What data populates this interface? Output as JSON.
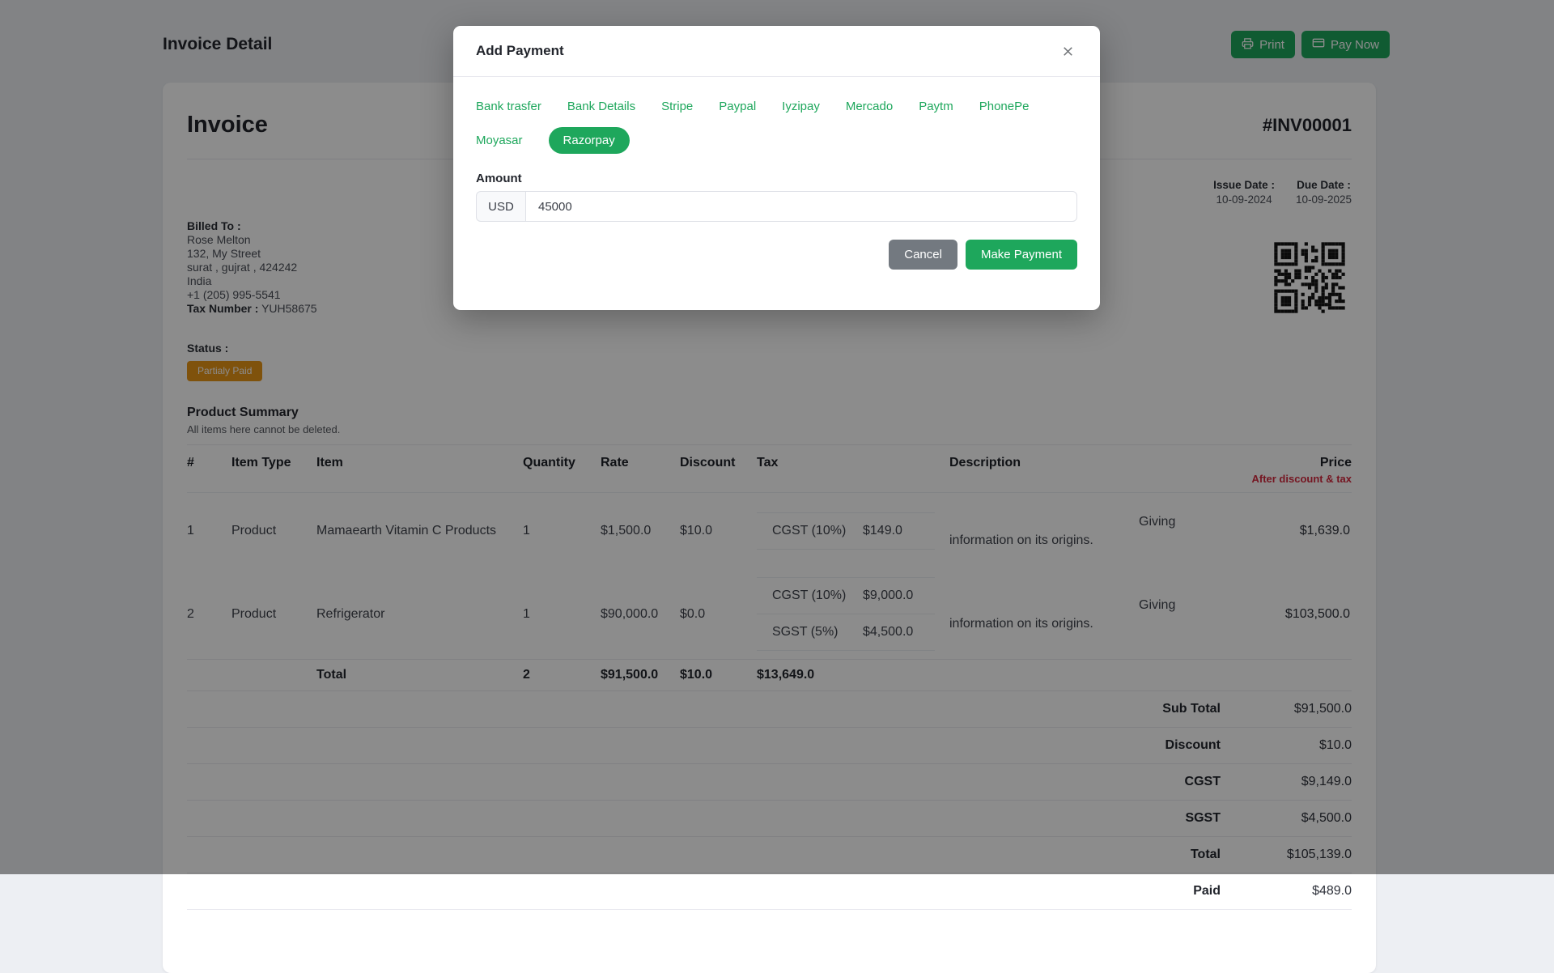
{
  "page": {
    "title": "Invoice Detail",
    "print_label": "Print",
    "pay_now_label": "Pay Now"
  },
  "invoice": {
    "heading": "Invoice",
    "number": "#INV00001",
    "issue_date_label": "Issue Date :",
    "issue_date": "10-09-2024",
    "due_date_label": "Due Date :",
    "due_date": "10-09-2025",
    "billed_to_label": "Billed To :",
    "billed_to": [
      "Rose Melton",
      "132, My Street",
      "surat , gujrat , 424242",
      "India",
      "+1 (205) 995-5541"
    ],
    "tax_number_label": "Tax Number :",
    "tax_number": "YUH58675",
    "status_label": "Status :",
    "status": "Partialy Paid"
  },
  "product_summary": {
    "title": "Product Summary",
    "subtitle": "All items here cannot be deleted.",
    "columns": [
      "#",
      "Item Type",
      "Item",
      "Quantity",
      "Rate",
      "Discount",
      "Tax",
      "Description",
      "Price"
    ],
    "price_subnote": "After discount & tax",
    "rows": [
      {
        "index": "1",
        "item_type": "Product",
        "item": "Mamaearth Vitamin C Products",
        "quantity": "1",
        "rate": "$1,500.0",
        "discount": "$10.0",
        "taxes": [
          {
            "name": "CGST (10%)",
            "amount": "$149.0"
          }
        ],
        "description": "Giving information on its origins.",
        "price": "$1,639.0"
      },
      {
        "index": "2",
        "item_type": "Product",
        "item": "Refrigerator",
        "quantity": "1",
        "rate": "$90,000.0",
        "discount": "$0.0",
        "taxes": [
          {
            "name": "CGST (10%)",
            "amount": "$9,000.0"
          },
          {
            "name": "SGST (5%)",
            "amount": "$4,500.0"
          }
        ],
        "description": "Giving information on its origins.",
        "price": "$103,500.0"
      }
    ],
    "total_row": {
      "label": "Total",
      "quantity": "2",
      "rate": "$91,500.0",
      "discount": "$10.0",
      "tax": "$13,649.0"
    },
    "summary": [
      {
        "label": "Sub Total",
        "value": "$91,500.0"
      },
      {
        "label": "Discount",
        "value": "$10.0"
      },
      {
        "label": "CGST",
        "value": "$9,149.0"
      },
      {
        "label": "SGST",
        "value": "$4,500.0"
      },
      {
        "label": "Total",
        "value": "$105,139.0"
      },
      {
        "label": "Paid",
        "value": "$489.0"
      }
    ]
  },
  "modal": {
    "title": "Add Payment",
    "tabs": [
      "Bank trasfer",
      "Bank Details",
      "Stripe",
      "Paypal",
      "Iyzipay",
      "Mercado",
      "Paytm",
      "PhonePe",
      "Moyasar",
      "Razorpay"
    ],
    "active_tab": "Razorpay",
    "amount_label": "Amount",
    "currency": "USD",
    "amount_value": "45000",
    "cancel_label": "Cancel",
    "submit_label": "Make Payment"
  },
  "colors": {
    "accent_green": "#1ea75c",
    "badge_orange": "#e79517",
    "price_note_red": "#d6293e",
    "cancel_gray": "#737980"
  }
}
